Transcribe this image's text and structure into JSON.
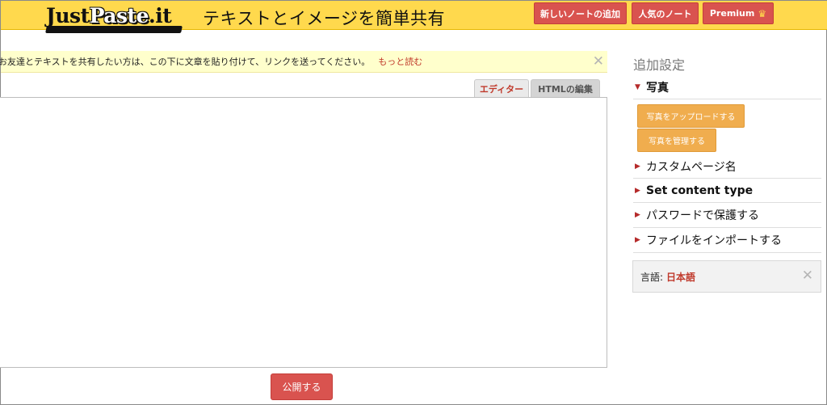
{
  "header": {
    "logo_a": "Just",
    "logo_b": "Paste",
    "logo_c": ".it",
    "tagline": "テキストとイメージを簡単共有",
    "new_note": "新しいノートの追加",
    "popular": "人気のノート",
    "premium": "Premium",
    "crown_icon": "crown-icon"
  },
  "info": {
    "message": "お友達とテキストを共有したい方は、この下に文章を貼り付けて、リンクを送ってください。",
    "more_link": "もっと読む",
    "close": "✕"
  },
  "tabs": [
    {
      "label": "エディター",
      "active": true
    },
    {
      "label": "HTMLの編集",
      "active": false
    }
  ],
  "editor": {
    "content": ""
  },
  "publish_label": "公開する",
  "sidebar": {
    "title": "追加設定",
    "photos": "写真",
    "upload": "写真をアップロードする",
    "manage": "写真を管理する",
    "custom_page": "カスタムページ名",
    "content_type": "Set content type",
    "password": "パスワードで保護する",
    "import": "ファイルをインポートする",
    "lang_label": "言語:",
    "lang_value": "日本語",
    "lang_close": "✕"
  },
  "colors": {
    "header_bg": "#ffd94d",
    "red": "#d9534f",
    "orange": "#f0ad4e",
    "info_bg": "#ffffcc"
  }
}
